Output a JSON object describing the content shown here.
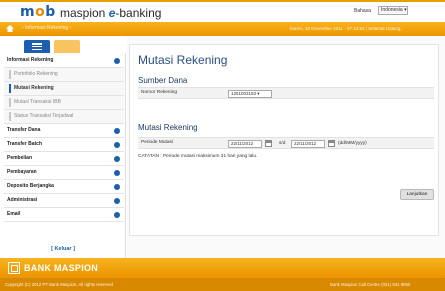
{
  "header": {
    "logo_text": "m",
    "logo_o": "o",
    "logo_rest": "b",
    "brand_name": "maspion ",
    "brand_e": "e",
    "brand_rest": "-banking",
    "language_label": "Bahasa",
    "language_value": "Indonesia"
  },
  "nav": {
    "breadcrumb": "Informasi Rekening",
    "date": "Kamis, 20 Desember 2011 - 07:13:52 | Selamat Datang,"
  },
  "sidebar": {
    "items": [
      {
        "label": "Informasi Rekening",
        "type": "group"
      },
      {
        "label": "Portofolio Rekening",
        "type": "sub"
      },
      {
        "label": "Mutasi Rekening",
        "type": "sub-active"
      },
      {
        "label": "Mutasi Transaksi IBB",
        "type": "sub"
      },
      {
        "label": "Status Transaksi Terjadwal",
        "type": "sub"
      },
      {
        "label": "Transfer Dana",
        "type": "group"
      },
      {
        "label": "Transfer Batch",
        "type": "group"
      },
      {
        "label": "Pembelian",
        "type": "group"
      },
      {
        "label": "Pembayaran",
        "type": "group"
      },
      {
        "label": "Deposito Berjangka",
        "type": "group"
      },
      {
        "label": "Administrasi",
        "type": "group"
      },
      {
        "label": "Email",
        "type": "group"
      }
    ],
    "logout_label": "[ Keluar ]"
  },
  "main": {
    "title": "Mutasi Rekening",
    "sumber_dana": {
      "heading": "Sumber Dana",
      "field_label": "Nomor Rekening",
      "field_value": "1251003193"
    },
    "mutasi": {
      "heading": "Mutasi Rekening",
      "period_label": "Periode Mutasi",
      "from_date": "22/11/2012",
      "separator": "s/d",
      "to_date": "22/11/2012",
      "format_hint": "(dd/MM/yyyy)",
      "note": "CATATAN : Periode mutasi maksimum 31 hari yang lalu."
    },
    "next_button": "Lanjutkan"
  },
  "footer": {
    "bank_name": "BANK MASPION",
    "copyright": "Copyright (C) 2012 PT Bank Maspion. All rights reserved",
    "call_center": "Bank Maspion Call Centre (031) 531 8080"
  },
  "colors": {
    "primary_blue": "#1b5fae",
    "accent_orange": "#f5a100"
  }
}
